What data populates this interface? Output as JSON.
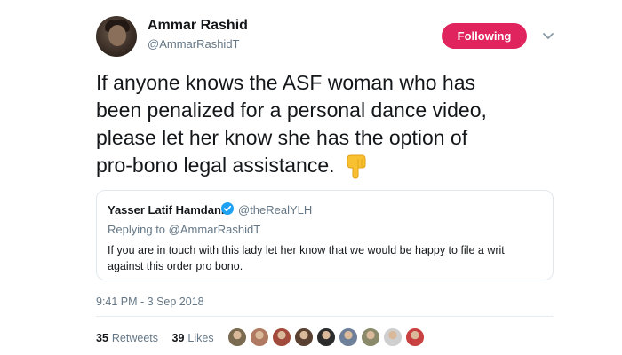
{
  "author": {
    "name": "Ammar Rashid",
    "handle": "@AmmarRashidT",
    "avatar_icon": "user-avatar"
  },
  "follow_button": {
    "label": "Following",
    "color": "#e0245e"
  },
  "menu_icon": "chevron-down-icon",
  "tweet": {
    "lines": [
      "If anyone knows the ASF woman who has",
      "been penalized for a personal dance video,",
      "please let her know she has the option of",
      "pro-bono legal assistance."
    ],
    "emoji_icon": "point-down-emoji"
  },
  "quoted_tweet": {
    "name": "Yasser Latif Hamdani",
    "verified_icon": "verified-badge-icon",
    "handle": "@theRealYLH",
    "replying_prefix": "Replying to",
    "replying_to": "@AmmarRashidT",
    "text": "If you are in touch with this lady let her know that we would be happy to file a writ against this order pro bono."
  },
  "timestamp": "9:41 PM - 3 Sep 2018",
  "stats": {
    "retweets_count": "35",
    "retweets_label": "Retweets",
    "likes_count": "39",
    "likes_label": "Likes"
  },
  "liker_avatars": [
    "#7a6a50",
    "#b07a62",
    "#a24a3c",
    "#5a4030",
    "#2c2c2c",
    "#6e7f99",
    "#8a8a6a",
    "#cfcfcf",
    "#c94040"
  ],
  "colors": {
    "accent": "#e0245e",
    "verified": "#1da1f2",
    "secondary_text": "#657786"
  }
}
